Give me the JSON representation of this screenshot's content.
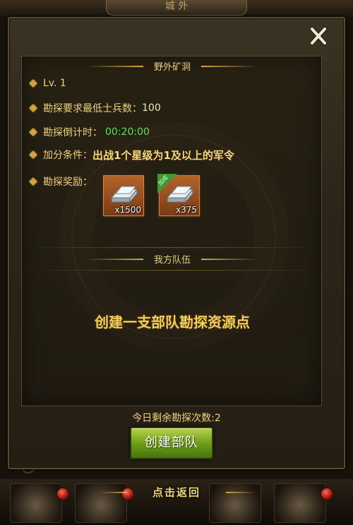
{
  "background": {
    "top_banner": "城 外",
    "back_label": "点击返回"
  },
  "dialog": {
    "close_icon": "close-x-icon",
    "cave": {
      "title": "野外矿洞",
      "level": "Lv. 1",
      "min_soldiers_label": "勘探要求最低士兵数：",
      "min_soldiers_value": "100",
      "countdown_label": "勘探倒计时：",
      "countdown_value": "00:20:00",
      "bonus_label": "加分条件：",
      "bonus_value": "出战1个星级为1及以上的军令",
      "rewards_label": "勘探奖励：",
      "rewards": [
        {
          "icon": "silver-ingot-icon",
          "qty": "x1500",
          "badge": ""
        },
        {
          "icon": "silver-ingot-icon",
          "qty": "x375",
          "badge": "加成"
        }
      ]
    },
    "team": {
      "title": "我方队伍",
      "message": "创建一支部队勘探资源点"
    },
    "remaining_text": "今日剩余勘探次数:2",
    "create_button": "创建部队"
  },
  "colors": {
    "accent_gold": "#f3cd5d",
    "countdown_green": "#5ee05a",
    "button_green": "#6a9a16"
  }
}
